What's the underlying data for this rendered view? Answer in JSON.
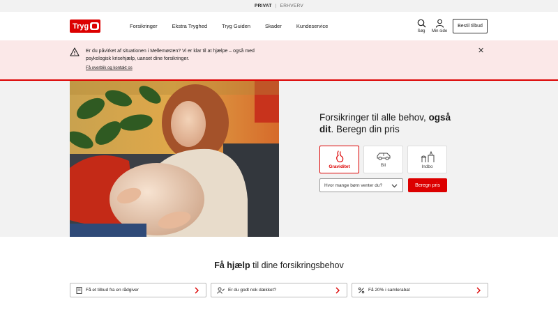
{
  "topbar": {
    "private": "PRIVAT",
    "separator": "|",
    "business": "ERHVERV"
  },
  "header": {
    "logo": "Tryg",
    "nav": [
      "Forsikringer",
      "Ekstra Tryghed",
      "Tryg Guiden",
      "Skader",
      "Kundeservice"
    ],
    "search_label": "Søg",
    "account_label": "Min side",
    "offer_button": "Bestil tilbud"
  },
  "banner": {
    "message": "Er du påvirket af situationen i Mellemøsten? Vi er klar til at hjælpe – også med psykologisk krisehjælp, uanset dine forsikringer.",
    "link": "Få overblik og kontakt os"
  },
  "hero": {
    "title_part1": "Forsikringer til alle behov, ",
    "title_bold": "også dit",
    "title_part2": ". Beregn din pris",
    "cards": [
      {
        "label": "Graviditet",
        "icon": "pregnancy-icon",
        "active": true
      },
      {
        "label": "Bil",
        "icon": "car-icon",
        "active": false
      },
      {
        "label": "Indbo",
        "icon": "home-contents-icon",
        "active": false
      }
    ],
    "select_placeholder": "Hvor mange børn venter du?",
    "calculate_button": "Beregn pris"
  },
  "help": {
    "title_bold": "Få hjælp",
    "title_rest": " til dine forsikringsbehov",
    "buttons": [
      {
        "label": "Få et tilbud fra en rådgiver",
        "icon": "document-icon"
      },
      {
        "label": "Er du godt nok dækket?",
        "icon": "person-check-icon"
      },
      {
        "label": "Få 20% i samlerabat",
        "icon": "percent-icon"
      }
    ]
  },
  "colors": {
    "brand_red": "#dc0000",
    "banner_bg": "#fbe8e8",
    "hero_bg": "#f2f2f2"
  }
}
